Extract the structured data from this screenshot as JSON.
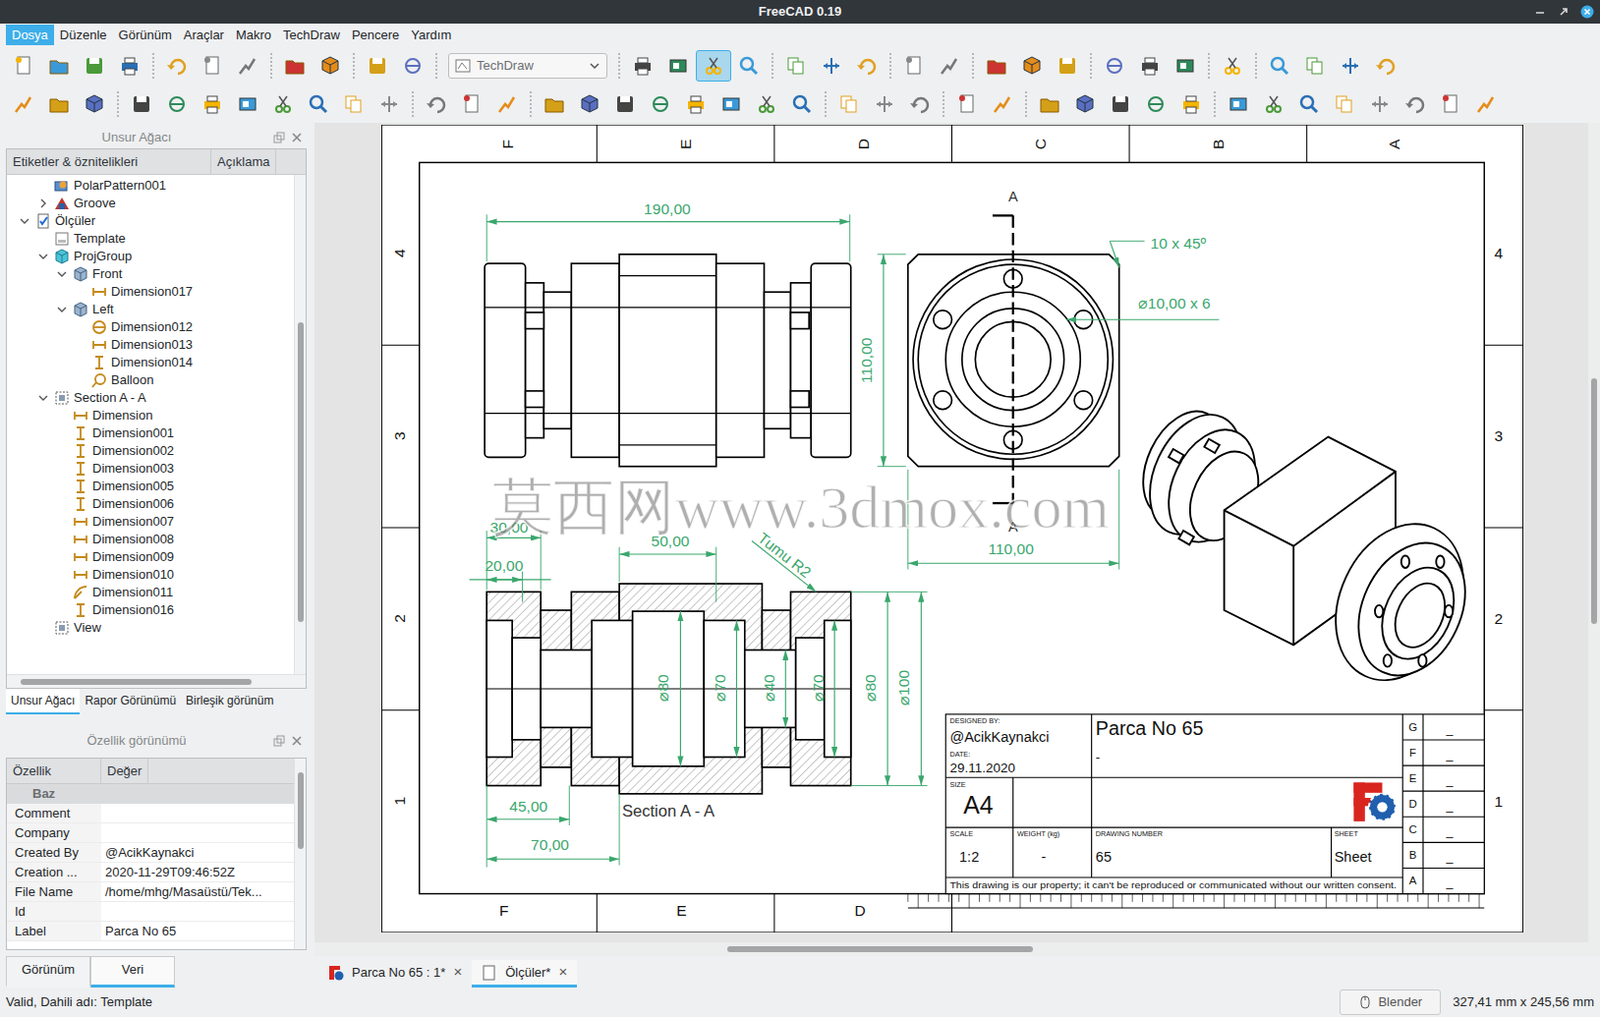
{
  "window": {
    "title": "FreeCAD 0.19"
  },
  "menu": [
    {
      "label": "Dosya",
      "selected": true
    },
    {
      "label": "Düzenle",
      "selected": false
    },
    {
      "label": "Görünüm",
      "selected": false
    },
    {
      "label": "Araçlar",
      "selected": false
    },
    {
      "label": "Makro",
      "selected": false
    },
    {
      "label": "TechDraw",
      "selected": false
    },
    {
      "label": "Pencere",
      "selected": false
    },
    {
      "label": "Yardım",
      "selected": false
    }
  ],
  "toolbar": {
    "workbench": "TechDraw",
    "rows": [
      [
        [
          false,
          false,
          false,
          false
        ],
        [
          false,
          false,
          false
        ],
        [
          false,
          false
        ],
        [
          false,
          false
        ],
        [
          false,
          false,
          true,
          false
        ],
        [
          false,
          false,
          false
        ],
        [
          false,
          false
        ],
        [
          false,
          false,
          false
        ],
        [
          false,
          false,
          false
        ],
        [
          false
        ],
        [
          false,
          false,
          false,
          false
        ]
      ],
      [
        [
          false,
          false,
          false
        ],
        [
          false,
          false,
          false,
          false,
          false,
          false,
          false,
          false
        ],
        [
          false,
          false,
          false
        ],
        [
          false,
          false,
          false,
          false,
          false,
          false,
          false,
          false
        ],
        [
          false,
          false,
          false
        ],
        [
          false,
          false
        ],
        [
          false,
          false,
          false,
          false,
          false
        ],
        [
          false,
          false,
          false,
          false,
          false,
          false,
          false,
          false
        ]
      ]
    ]
  },
  "tree": {
    "title": "Unsur Ağacı",
    "columns": [
      "Etiketler & öznitelikleri",
      "Açıklama"
    ],
    "items": [
      {
        "label": "PolarPattern001",
        "depth": 2,
        "kind": "feature",
        "expandable": false,
        "expanded": false
      },
      {
        "label": "Groove",
        "depth": 2,
        "kind": "groove",
        "expandable": true,
        "expanded": false
      },
      {
        "label": "Ölçüler",
        "depth": 1,
        "kind": "page",
        "expandable": true,
        "expanded": true
      },
      {
        "label": "Template",
        "depth": 2,
        "kind": "template",
        "expandable": false,
        "expanded": false
      },
      {
        "label": "ProjGroup",
        "depth": 2,
        "kind": "projgroup",
        "expandable": true,
        "expanded": true
      },
      {
        "label": "Front",
        "depth": 3,
        "kind": "view",
        "expandable": true,
        "expanded": true
      },
      {
        "label": "Dimension017",
        "depth": 4,
        "kind": "dim-h",
        "expandable": false,
        "expanded": false
      },
      {
        "label": "Left",
        "depth": 3,
        "kind": "view",
        "expandable": true,
        "expanded": true
      },
      {
        "label": "Dimension012",
        "depth": 4,
        "kind": "dim-diam",
        "expandable": false,
        "expanded": false
      },
      {
        "label": "Dimension013",
        "depth": 4,
        "kind": "dim-h",
        "expandable": false,
        "expanded": false
      },
      {
        "label": "Dimension014",
        "depth": 4,
        "kind": "dim-v",
        "expandable": false,
        "expanded": false
      },
      {
        "label": "Balloon",
        "depth": 4,
        "kind": "balloon",
        "expandable": false,
        "expanded": false
      },
      {
        "label": "Section A - A",
        "depth": 2,
        "kind": "section",
        "expandable": true,
        "expanded": true
      },
      {
        "label": "Dimension",
        "depth": 3,
        "kind": "dim-h",
        "expandable": false,
        "expanded": false
      },
      {
        "label": "Dimension001",
        "depth": 3,
        "kind": "dim-v",
        "expandable": false,
        "expanded": false
      },
      {
        "label": "Dimension002",
        "depth": 3,
        "kind": "dim-v",
        "expandable": false,
        "expanded": false
      },
      {
        "label": "Dimension003",
        "depth": 3,
        "kind": "dim-v",
        "expandable": false,
        "expanded": false
      },
      {
        "label": "Dimension005",
        "depth": 3,
        "kind": "dim-v",
        "expandable": false,
        "expanded": false
      },
      {
        "label": "Dimension006",
        "depth": 3,
        "kind": "dim-v",
        "expandable": false,
        "expanded": false
      },
      {
        "label": "Dimension007",
        "depth": 3,
        "kind": "dim-h",
        "expandable": false,
        "expanded": false
      },
      {
        "label": "Dimension008",
        "depth": 3,
        "kind": "dim-h",
        "expandable": false,
        "expanded": false
      },
      {
        "label": "Dimension009",
        "depth": 3,
        "kind": "dim-h",
        "expandable": false,
        "expanded": false
      },
      {
        "label": "Dimension010",
        "depth": 3,
        "kind": "dim-h",
        "expandable": false,
        "expanded": false
      },
      {
        "label": "Dimension011",
        "depth": 3,
        "kind": "dim-radius",
        "expandable": false,
        "expanded": false
      },
      {
        "label": "Dimension016",
        "depth": 3,
        "kind": "dim-v",
        "expandable": false,
        "expanded": false
      },
      {
        "label": "View",
        "depth": 2,
        "kind": "section",
        "expandable": false,
        "expanded": false
      }
    ]
  },
  "left_tabs": [
    {
      "label": "Unsur Ağacı",
      "selected": true
    },
    {
      "label": "Rapor Görünümü",
      "selected": false
    },
    {
      "label": "Birleşik görünüm",
      "selected": false
    }
  ],
  "properties": {
    "title": "Özellik görünümü",
    "columns": [
      "Özellik",
      "Değer"
    ],
    "group": "Baz",
    "rows": [
      {
        "name": "Comment"
      },
      {
        "name": "Company"
      },
      {
        "name": "Created By",
        "value": "@AcikKaynakci"
      },
      {
        "name": "Creation ...",
        "value": "2020-11-29T09:46:52Z"
      },
      {
        "name": "File Name",
        "value": "/home/mhg/Masaüstü/Tek..."
      },
      {
        "name": "Id"
      },
      {
        "name": "Label",
        "value": "Parca No 65"
      }
    ]
  },
  "bottom_tabs": [
    {
      "label": "Görünüm",
      "selected": false
    },
    {
      "label": "Veri",
      "selected": true
    }
  ],
  "documents": [
    {
      "label": "Parca No 65 : 1*",
      "kind": "document",
      "selected": false,
      "close": "×"
    },
    {
      "label": "Ölçüler*",
      "kind": "page",
      "selected": true,
      "close": "×"
    }
  ],
  "scrollbars": {
    "tree_vertical": {
      "level": 0.6
    },
    "tree_horizontal": {
      "level": 0.85
    },
    "properties_vertical": {
      "level": 0.4
    },
    "canvas_vertical": {
      "level": 0.3
    },
    "canvas_horizontal": {
      "level": 0.35
    }
  },
  "drawing": {
    "zones_top": [
      "F",
      "E",
      "D",
      "C",
      "B",
      "A"
    ],
    "zones_bottom": [
      "F",
      "E",
      "D"
    ],
    "zones_left": [
      "4",
      "3",
      "2",
      "1"
    ],
    "zones_right": [
      "4",
      "3",
      "2",
      "1"
    ],
    "section_marks": [
      "A",
      "A"
    ],
    "dimensions": [
      "190,00",
      "110,00",
      "10 x 45º",
      "⌀10,00 x 6",
      "110,00",
      "30,00",
      "20,00",
      "50,00",
      "Tumu R2",
      "⌀80",
      "⌀70",
      "⌀40",
      "⌀70",
      "⌀80",
      "⌀100",
      "45,00",
      "70,00"
    ],
    "view_label": "Section A - A",
    "title_block": {
      "designed_by_label": "DESIGNED BY:",
      "designer": "@AcikKaynakci",
      "date_label": "DATE:",
      "date": "29.11.2020",
      "title": "Parca No 65",
      "subtitle": "-",
      "size_label": "SIZE",
      "size": "A4",
      "scale_label": "SCALE",
      "scale": "1:2",
      "weight_label": "WEIGHT (kg)",
      "weight": "-",
      "number_label": "DRAWING NUMBER",
      "number": "65",
      "sheet_label": "SHEET",
      "sheet": "Sheet",
      "disclaimer": "This drawing is our property; it can't be reproduced or communicated without our written consent.",
      "revisions": [
        {
          "letter": "G",
          "value": "_"
        },
        {
          "letter": "F",
          "value": "_"
        },
        {
          "letter": "E",
          "value": "_"
        },
        {
          "letter": "D",
          "value": "_"
        },
        {
          "letter": "C",
          "value": "_"
        },
        {
          "letter": "B",
          "value": "_"
        },
        {
          "letter": "A",
          "value": "_"
        }
      ]
    },
    "watermark": "莫西网www.3dmox.com"
  },
  "status_bar": {
    "message": "Valid, Dahili adı: Template",
    "navigation": "Blender",
    "dimensions": "327,41 mm x 245,56 mm"
  }
}
